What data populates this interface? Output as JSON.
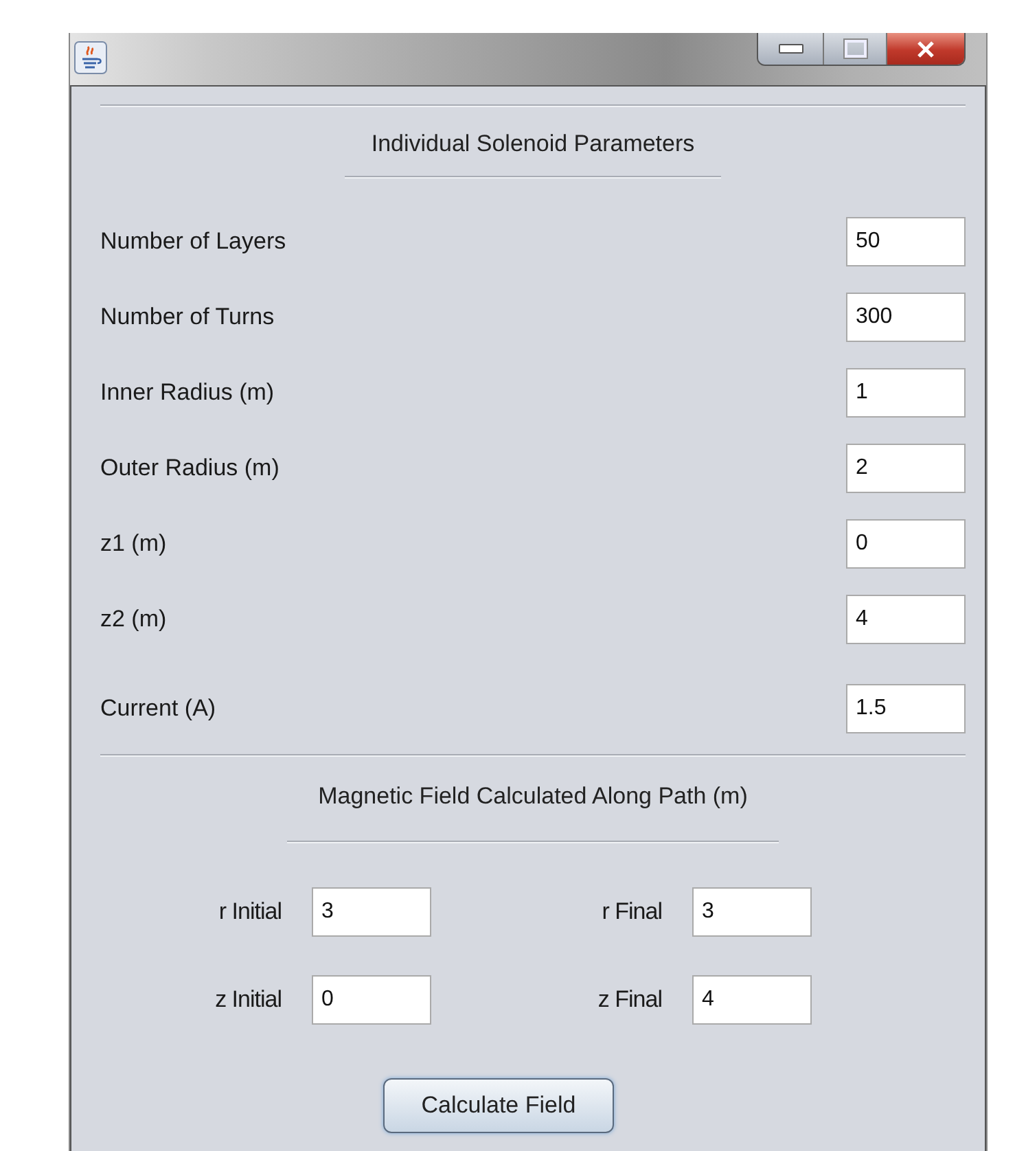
{
  "window": {
    "controls": [
      {
        "kind": "minimize"
      },
      {
        "kind": "maximize"
      },
      {
        "kind": "close"
      }
    ]
  },
  "solenoid": {
    "heading": "Individual Solenoid Parameters",
    "fields": [
      {
        "label": "Number of Layers",
        "value": "50"
      },
      {
        "label": "Number of Turns",
        "value": "300"
      },
      {
        "label": "Inner Radius (m)",
        "value": "1"
      },
      {
        "label": "Outer Radius (m)",
        "value": "2"
      },
      {
        "label": "z1 (m)",
        "value": "0"
      },
      {
        "label": "z2 (m)",
        "value": "4"
      },
      {
        "label": "Current (A)",
        "value": "1.5"
      }
    ]
  },
  "path": {
    "heading": "Magnetic Field Calculated Along Path (m)",
    "fields": [
      {
        "label": "r Initial",
        "value": "3"
      },
      {
        "label": "r Final",
        "value": "3"
      },
      {
        "label": "z Initial",
        "value": "0"
      },
      {
        "label": "z Final",
        "value": "4"
      }
    ]
  },
  "button": "Calculate Field"
}
